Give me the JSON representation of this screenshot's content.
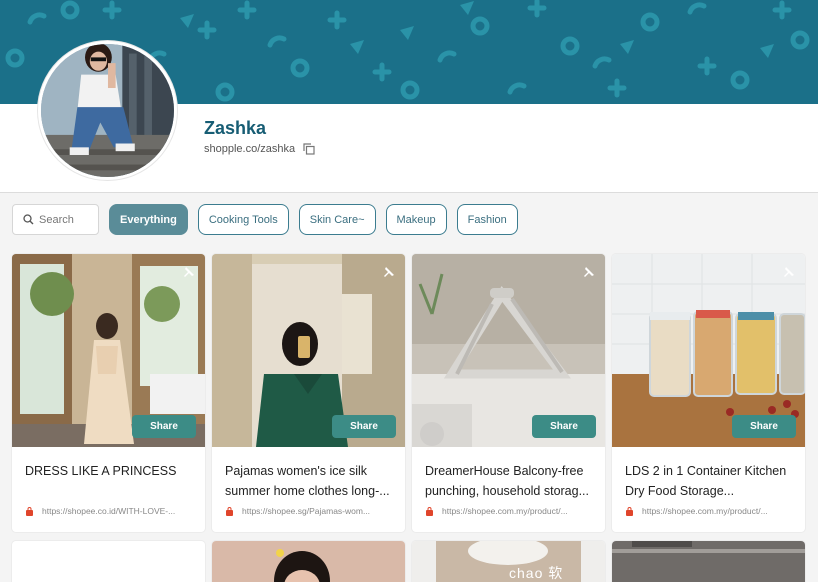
{
  "profile": {
    "name": "Zashka",
    "handle": "shopple.co/zashka"
  },
  "search": {
    "placeholder": "Search"
  },
  "filters": [
    "Everything",
    "Cooking Tools",
    "Skin Care~",
    "Makeup",
    "Fashion"
  ],
  "active_filter": "Everything",
  "cards": [
    {
      "title": "DRESS LIKE A PRINCESS",
      "source": "https://shopee.co.id/WITH-LOVE-...",
      "share_label": "Share"
    },
    {
      "title": "Pajamas women's ice silk summer home clothes long-...",
      "source": "https://shopee.sg/Pajamas-wom...",
      "share_label": "Share"
    },
    {
      "title": "DreamerHouse Balcony-free punching, household storag...",
      "source": "https://shopee.com.my/product/...",
      "share_label": "Share"
    },
    {
      "title": "LDS 2 in 1 Container Kitchen Dry Food Storage...",
      "source": "https://shopee.com.my/product/...",
      "share_label": "Share"
    }
  ],
  "row2_caption": "chao 软",
  "colors": {
    "banner": "#1b7089",
    "accent": "#175d74",
    "share": "#3c8c86",
    "active_chip": "#5a8c98"
  },
  "icons": [
    "search-icon",
    "copy-icon",
    "pin-icon",
    "shop-icon"
  ]
}
